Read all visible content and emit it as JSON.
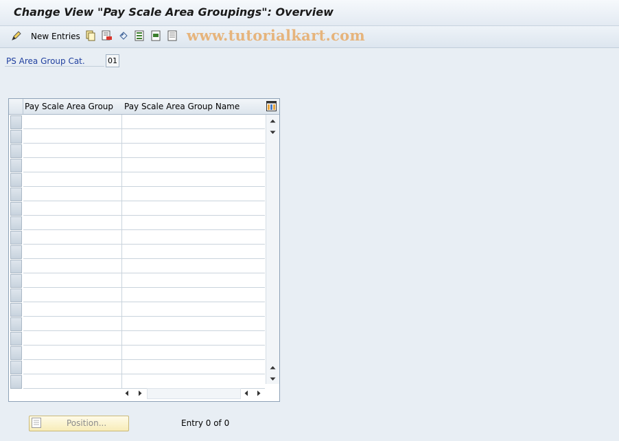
{
  "window": {
    "title": "Change View \"Pay Scale Area Groupings\": Overview"
  },
  "toolbar": {
    "new_entries_label": "New Entries",
    "icons": [
      "edit-icon",
      "copy-icon",
      "delete-icon",
      "undo-icon",
      "select-all-icon",
      "select-block-icon",
      "deselect-all-icon"
    ]
  },
  "watermark": "www.tutorialkart.com",
  "filter": {
    "label": "PS Area Group Cat.",
    "value": "01"
  },
  "table": {
    "columns": [
      "Pay Scale Area Group",
      "Pay Scale Area Group Name"
    ],
    "rows": 19
  },
  "footer": {
    "position_label": "Position...",
    "entry_text": "Entry 0 of 0"
  },
  "colors": {
    "background": "#e8eef4",
    "label_blue": "#1f3f9f",
    "watermark": "#e6b47c",
    "button_yellow": "#f7ecb8"
  }
}
